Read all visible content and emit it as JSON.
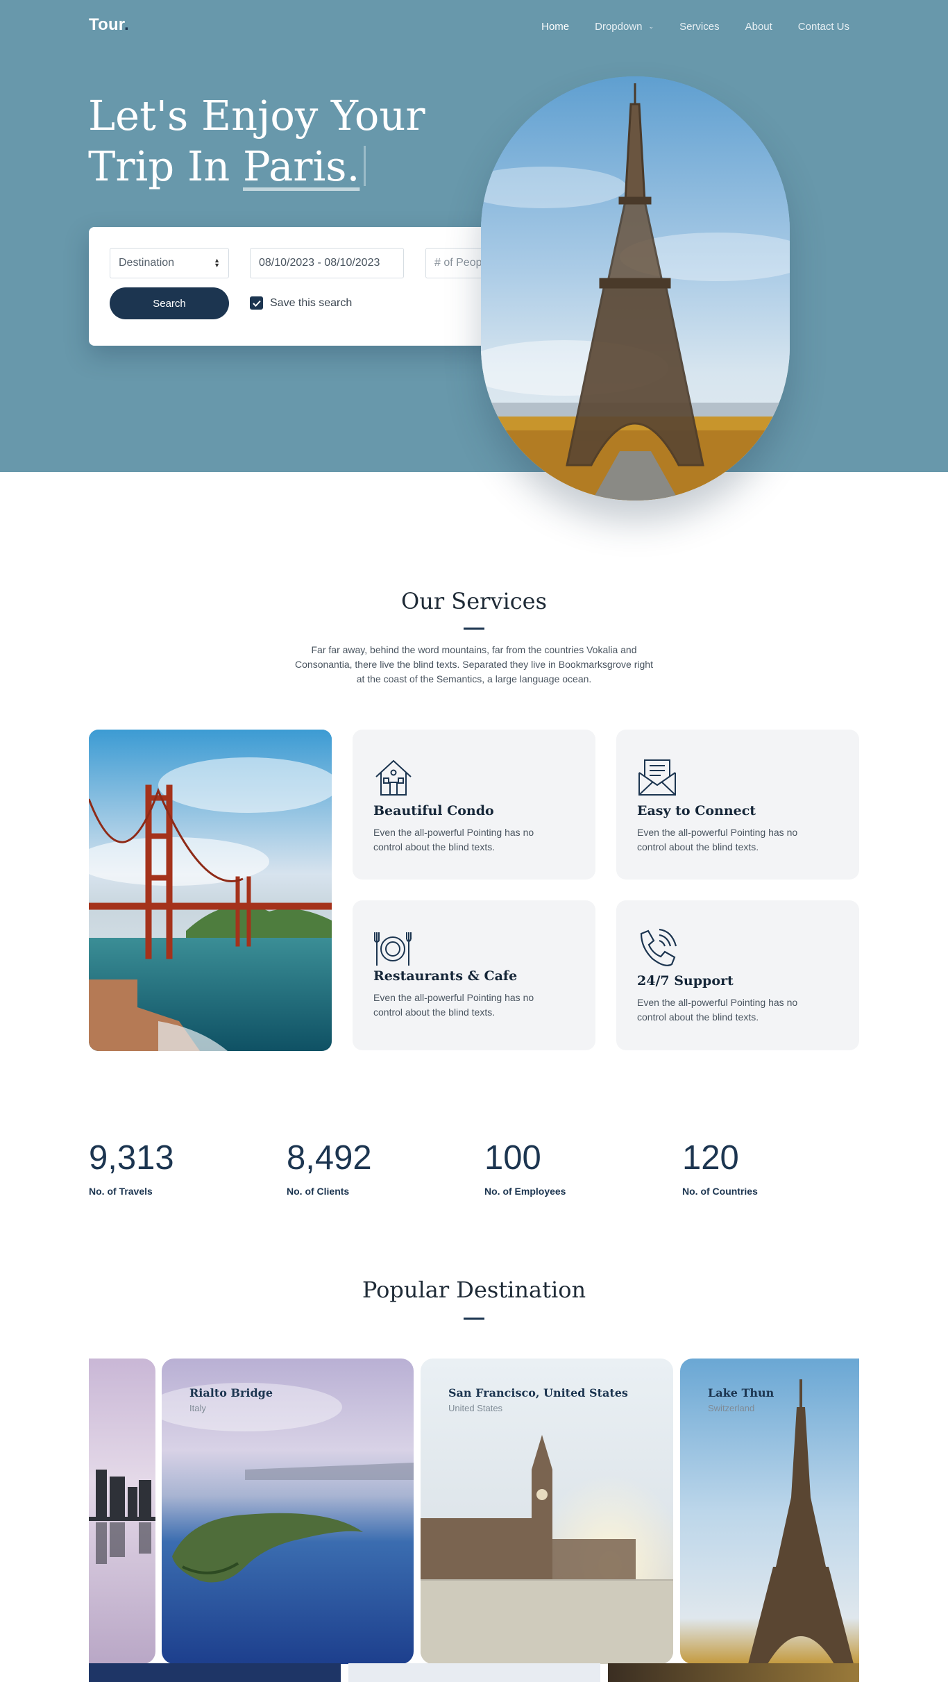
{
  "brand": {
    "name": "Tour",
    "dot": "."
  },
  "nav": [
    {
      "label": "Home",
      "active": true
    },
    {
      "label": "Dropdown",
      "has_caret": true
    },
    {
      "label": "Services"
    },
    {
      "label": "About"
    },
    {
      "label": "Contact Us"
    }
  ],
  "hero": {
    "title_line1": "Let's Enjoy Your",
    "title_line2_prefix": "Trip In ",
    "title_highlight": "Paris."
  },
  "search": {
    "destination_value": "Destination",
    "date_value": "08/10/2023 - 08/10/2023",
    "people_placeholder": "# of People",
    "search_label": "Search",
    "save_label": "Save this search",
    "save_checked": true
  },
  "services": {
    "title": "Our Services",
    "subtitle": "Far far away, behind the word mountains, far from the countries Vokalia and Consonantia, there live the blind texts. Separated they live in Bookmarksgrove right at the coast of the Semantics, a large language ocean.",
    "items": [
      {
        "icon": "house-icon",
        "title": "Beautiful Condo",
        "text": "Even the all-powerful Pointing has no control about the blind texts."
      },
      {
        "icon": "envelope-icon",
        "title": "Easy to Connect",
        "text": "Even the all-powerful Pointing has no control about the blind texts."
      },
      {
        "icon": "plate-utensils-icon",
        "title": "Restaurants & Cafe",
        "text": "Even the all-powerful Pointing has no control about the blind texts."
      },
      {
        "icon": "phone-call-icon",
        "title": "24/7 Support",
        "text": "Even the all-powerful Pointing has no control about the blind texts."
      }
    ]
  },
  "stats": [
    {
      "value": "9,313",
      "label": "No. of Travels"
    },
    {
      "value": "8,492",
      "label": "No. of Clients"
    },
    {
      "value": "100",
      "label": "No. of Employees"
    },
    {
      "value": "120",
      "label": "No. of Countries"
    }
  ],
  "destinations": {
    "title": "Popular Destination",
    "items": [
      {
        "name": "Rialto Bridge",
        "country": "Italy"
      },
      {
        "name": "San Francisco, United States",
        "country": "United States"
      },
      {
        "name": "Lake Thun",
        "country": "Switzerland"
      }
    ]
  },
  "colors": {
    "hero_bg": "#6898ab",
    "accent": "#1c3550",
    "card_bg": "#f3f4f6"
  }
}
